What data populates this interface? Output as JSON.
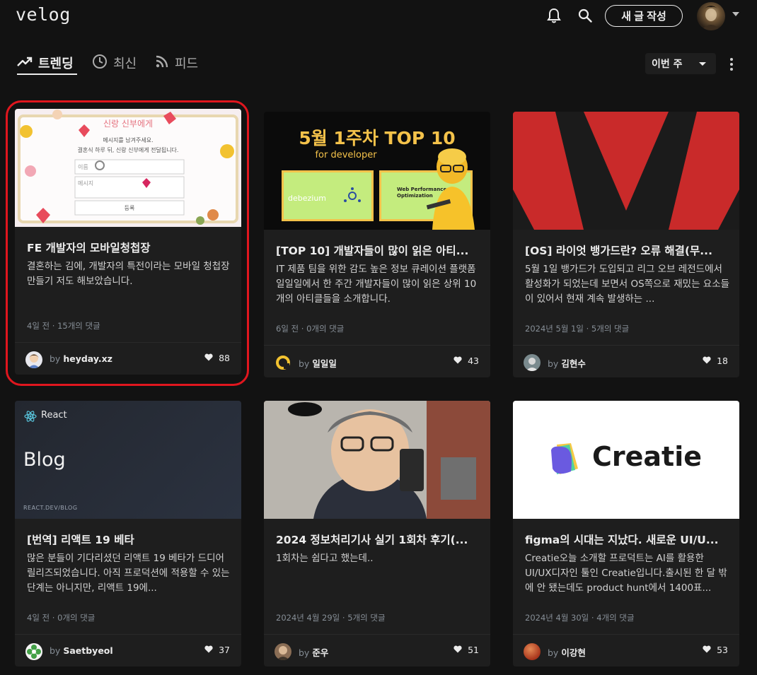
{
  "header": {
    "logo": "velog",
    "new_post_label": "새 글 작성",
    "icons": [
      "bell-icon",
      "search-icon"
    ]
  },
  "tabs": [
    {
      "label": "트렌딩",
      "icon": "trending-icon",
      "active": true
    },
    {
      "label": "최신",
      "icon": "clock-icon",
      "active": false
    },
    {
      "label": "피드",
      "icon": "rss-icon",
      "active": false
    }
  ],
  "period_select": "이번 주",
  "cards": [
    {
      "title": "FE 개발자의 모바일청첩장",
      "description": "결혼하는 김에, 개발자의 특전이라는 모바일 청첩장 만들기 저도 해보았습니다.",
      "meta": "4일 전 · 15개의 댓글",
      "by": "by",
      "author": "heyday.xz",
      "likes": "88",
      "thumb": {
        "heading": "신랑 신부에게",
        "line1": "메시지를 남겨주세요.",
        "line2": "결혼식 하루 뒤, 신랑 신부에게 전달됩니다.",
        "field_name": "이름",
        "field_message": "메시지",
        "submit": "등록"
      }
    },
    {
      "title": "[TOP 10] 개발자들이 많이 읽은 아티...",
      "description": "IT 제품 팀을 위한 감도 높은 정보 큐레이션 플랫폼 일일일에서 한 주간 개발자들이 많이 읽은 상위 10개의 아티클들을 소개합니다.",
      "meta": "6일 전 · 0개의 댓글",
      "by": "by",
      "author": "일일일",
      "likes": "43",
      "thumb": {
        "heading": "5월 1주차 TOP 10",
        "sub": "for developer",
        "box1": "debezium",
        "box2_line1": "Web Performance",
        "box2_line2": "Optimization"
      }
    },
    {
      "title": "[OS] 라이엇 뱅가드란? 오류 해결(무...",
      "description": "5월 1일 뱅가드가 도입되고 리그 오브 레전드에서 활성화가 되었는데 보면서 OS쪽으로 재밌는 요소들이 있어서 현재 계속 발생하는 ...",
      "meta": "2024년 5월 1일 · 5개의 댓글",
      "by": "by",
      "author": "김현수",
      "likes": "18"
    },
    {
      "title": "[번역] 리액트 19 베타",
      "description": "많은 분들이 기다리셨던 리액트 19 베타가 드디어 릴리즈되었습니다. 아직 프로덕션에 적용할 수 있는 단계는 아니지만, 리액트 19에...",
      "meta": "4일 전 · 0개의 댓글",
      "by": "by",
      "author": "Saetbyeol",
      "likes": "37",
      "thumb": {
        "tag": "React",
        "heading": "Blog",
        "footer": "REACT.DEV/BLOG"
      }
    },
    {
      "title": "2024 정보처리기사 실기 1회차 후기(...",
      "description": "1회차는 쉽다고 했는데..",
      "meta": "2024년 4월 29일 · 5개의 댓글",
      "by": "by",
      "author": "준우",
      "likes": "51"
    },
    {
      "title": "figma의 시대는 지났다. 새로운 UI/U...",
      "description": "Creatie오늘 소개할 프로덕트는 AI를 활용한 UI/UX디자인 툴인 Creatie입니다.출시된 한 달 밖에 안 됐는데도 product hunt에서 1400표...",
      "meta": "2024년 4월 30일 · 4개의 댓글",
      "by": "by",
      "author": "이강현",
      "likes": "53",
      "thumb": {
        "brand": "Creatie"
      }
    }
  ],
  "colors": {
    "background": "#121212",
    "card": "#1e1e1e",
    "highlight": "#e0161e"
  }
}
